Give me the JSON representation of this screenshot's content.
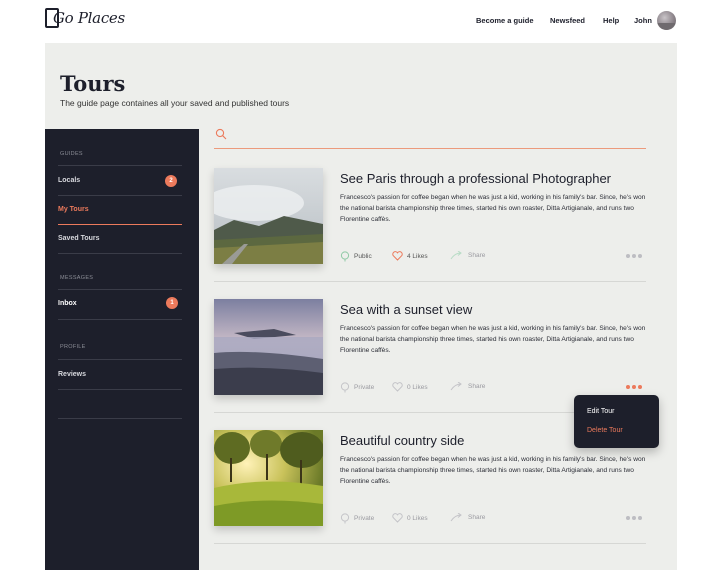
{
  "header": {
    "logo_text": "Go Places",
    "nav": [
      {
        "label": "Become a guide"
      },
      {
        "label": "Newsfeed"
      },
      {
        "label": "Help"
      }
    ],
    "user_name": "John"
  },
  "page": {
    "title": "Tours",
    "subtitle": "The guide page containes all your saved and published tours"
  },
  "sidebar": {
    "sections": [
      {
        "heading": "GUIDES"
      },
      {
        "heading": "MESSAGES"
      },
      {
        "heading": "PROFILE"
      }
    ],
    "items": [
      {
        "label": "Locals",
        "badge": "2"
      },
      {
        "label": "My Tours"
      },
      {
        "label": "Saved Tours"
      },
      {
        "label": "Inbox",
        "badge": "1"
      },
      {
        "label": "Reviews"
      }
    ],
    "active_item": "My Tours"
  },
  "search": {
    "placeholder": ""
  },
  "tours": [
    {
      "title": "See Paris through a professional Photographer",
      "description": "Francesco's passion for coffee began when he was just a kid, working in his family's bar. Since, he's  won the national barista championship three times, started his own roaster, Ditta Artigianale, and runs two Florentine caffès.",
      "visibility": "Public",
      "likes": "4 Likes",
      "share": "Share",
      "image": "mountain-road-photo"
    },
    {
      "title": "Sea with a sunset view",
      "description": "Francesco's passion for coffee began when he was just a kid, working in his family's bar. Since, he's  won the national barista championship three times, started his own roaster, Ditta Artigianale, and runs two Florentine caffès.",
      "visibility": "Private",
      "likes": "0 Likes",
      "share": "Share",
      "image": "sea-sunset-photo"
    },
    {
      "title": "Beautiful country side",
      "description": "Francesco's passion for coffee began when he was just a kid, working in his family's bar. Since, he's  won the national barista championship three times, started his own roaster, Ditta Artigianale, and runs two Florentine caffès.",
      "visibility": "Private",
      "likes": "0 Likes",
      "share": "Share",
      "image": "countryside-photo"
    }
  ],
  "context_menu": {
    "items": [
      {
        "label": "Edit Tour"
      },
      {
        "label": "Delete Tour"
      }
    ]
  },
  "colors": {
    "accent": "#ec7a5c",
    "sidebar_bg": "#1d1f2b",
    "panel_bg": "#edeeeb"
  }
}
